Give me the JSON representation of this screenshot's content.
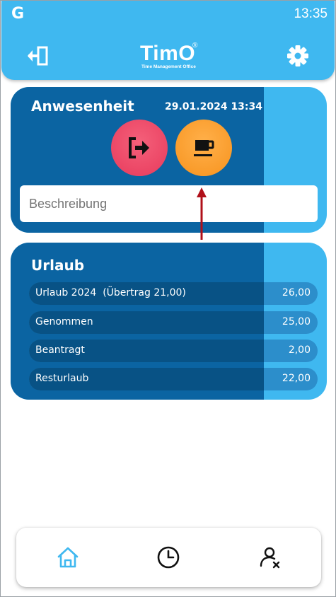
{
  "status_bar": {
    "app_letter": "G",
    "time": "13:35"
  },
  "header": {
    "logo_text": "TimO",
    "logo_registered": "®",
    "logo_subtitle": "Time Management Office",
    "left_icon": "logout-icon",
    "right_icon": "gear-icon"
  },
  "attendance": {
    "title": "Anwesenheit",
    "datetime": "29.01.2024 13:34",
    "buttons": [
      {
        "icon": "clock-out-icon",
        "color": "#e9405f"
      },
      {
        "icon": "coffee-cup-icon",
        "color": "#f7941d"
      }
    ],
    "description_placeholder": "Beschreibung"
  },
  "vacation": {
    "title": "Urlaub",
    "rows": [
      {
        "label": "Urlaub 2024  (Übertrag 21,00)",
        "value": "26,00"
      },
      {
        "label": "Genommen",
        "value": "25,00"
      },
      {
        "label": "Beantragt",
        "value": "2,00"
      },
      {
        "label": "Resturlaub",
        "value": "22,00"
      }
    ]
  },
  "bottom_nav": {
    "items": [
      {
        "icon": "home-icon",
        "active": true
      },
      {
        "icon": "clock-icon",
        "active": false
      },
      {
        "icon": "user-remove-icon",
        "active": false
      }
    ]
  },
  "colors": {
    "primary": "#3fb8f0",
    "dark_blue": "#0b64a2",
    "row_dark": "#085285",
    "accent_red": "#e9405f",
    "accent_orange": "#f7941d",
    "annotation_arrow": "#b0101a"
  }
}
